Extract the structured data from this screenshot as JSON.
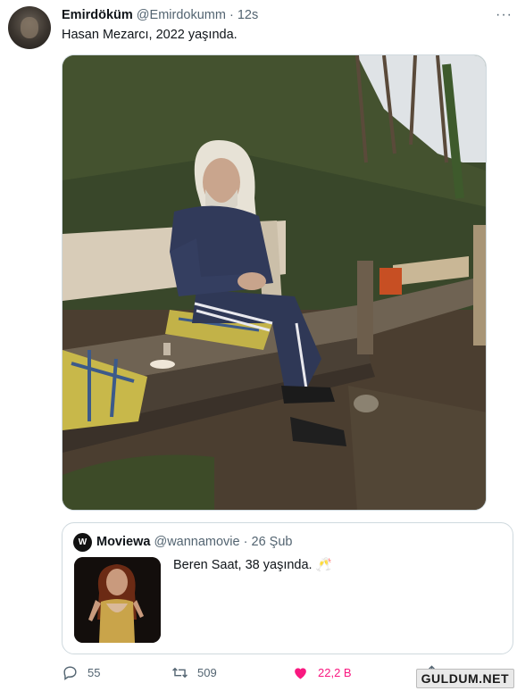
{
  "tweet": {
    "author_name": "Emirdöküm",
    "author_handle": "@Emirdokumm",
    "separator": "·",
    "time": "12s",
    "more_icon": "more-horizontal-icon",
    "text": "Hasan Mezarcı, 2022 yaşında."
  },
  "quoted": {
    "author_name": "Moviewa",
    "author_handle": "@wannamovie",
    "separator": "·",
    "date": "26 Şub",
    "text": "Beren Saat, 38 yaşında.",
    "emoji": "🥂"
  },
  "actions": {
    "reply_count": "55",
    "retweet_count": "509",
    "like_count": "22,2 B"
  },
  "watermark": "GULDUM.NET",
  "colors": {
    "secondary_text": "#536471",
    "like_pink": "#f91880",
    "border": "#cfd9de"
  }
}
